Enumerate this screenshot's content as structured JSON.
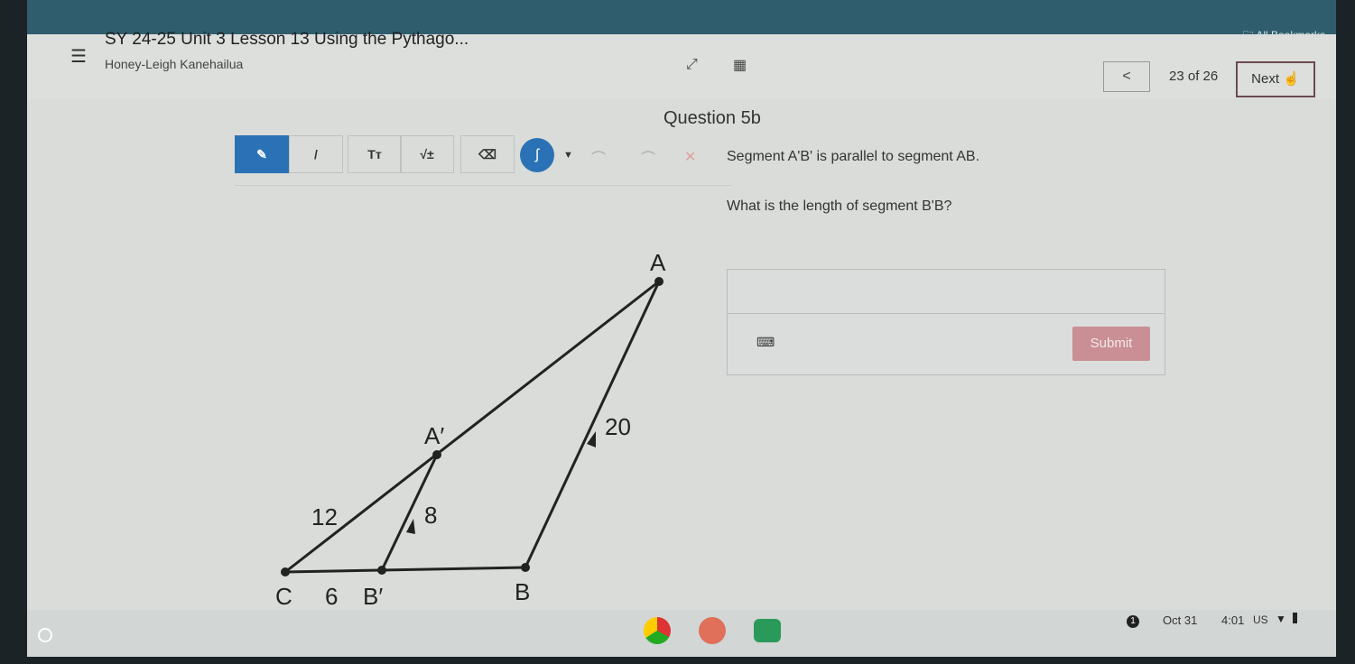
{
  "browser": {
    "bookmarks_label": "All Bookmarks"
  },
  "header": {
    "title": "SY 24-25 Unit 3 Lesson 13 Using the Pythago...",
    "student": "Honey-Leigh Kanehailua",
    "prev_label": "<",
    "page_count": "23 of 26",
    "next_label": "Next"
  },
  "question": {
    "title": "Question 5b",
    "line1": "Segment A'B' is parallel to segment AB.",
    "line2": "What is the length of segment B'B?",
    "submit_label": "Submit",
    "answer_value": ""
  },
  "toolbar": {
    "tools": [
      "pencil-icon",
      "line-icon",
      "text-size-icon",
      "math-icon",
      "eraser-icon",
      "color-icon",
      "dropdown-icon",
      "undo-icon",
      "redo-icon",
      "clear-icon"
    ],
    "text_label": "Tт",
    "math_label": "√±"
  },
  "diagram": {
    "points": [
      "A",
      "A′",
      "C",
      "B′",
      "B"
    ],
    "lengths": {
      "CA_prime": "12",
      "A_primeB_prime": "8",
      "AB": "20",
      "CB_prime": "6"
    }
  },
  "taskbar": {
    "date": "Oct 31",
    "time": "4:01",
    "locale": "US"
  },
  "colors": {
    "accent": "#2a72b5",
    "submit": "#c98f95"
  }
}
